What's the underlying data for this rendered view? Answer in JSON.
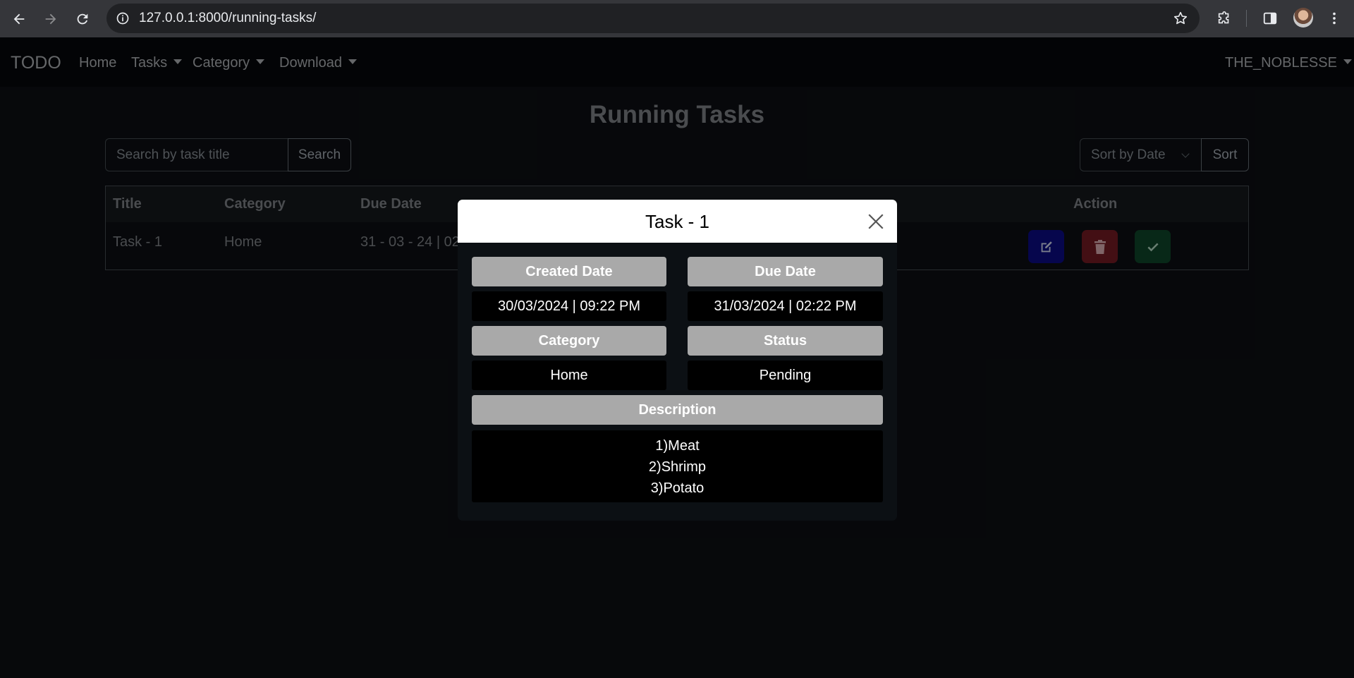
{
  "browser": {
    "url": "127.0.0.1:8000/running-tasks/"
  },
  "navbar": {
    "brand": "TODO",
    "links": [
      "Home",
      "Tasks",
      "Category",
      "Download"
    ],
    "user": "THE_NOBLESSE"
  },
  "page": {
    "title": "Running Tasks",
    "search": {
      "placeholder": "Search by task title",
      "button": "Search"
    },
    "sort": {
      "selected": "Sort by Date",
      "button": "Sort"
    }
  },
  "table": {
    "headers": {
      "title": "Title",
      "category": "Category",
      "due_date": "Due Date",
      "action": "Action"
    },
    "rows": [
      {
        "title": "Task - 1",
        "category": "Home",
        "due_date": "31 - 03 - 24 | 02"
      }
    ]
  },
  "modal": {
    "title": "Task - 1",
    "created_label": "Created Date",
    "created_value": "30/03/2024 | 09:22 PM",
    "due_label": "Due Date",
    "due_value": "31/03/2024 | 02:22 PM",
    "category_label": "Category",
    "category_value": "Home",
    "status_label": "Status",
    "status_value": "Pending",
    "description_label": "Description",
    "description_lines": [
      "1)Meat",
      "2)Shrimp",
      "3)Potato"
    ]
  },
  "colors": {
    "edit_button": "#0b0b8c",
    "delete_button": "#7a1d25",
    "done_button": "#104a2c",
    "modal_label_bg": "#a9a9a9"
  },
  "icons": [
    "back-icon",
    "forward-icon",
    "reload-icon",
    "info-icon",
    "star-icon",
    "extensions-icon",
    "sidepanel-icon",
    "menu-icon",
    "edit-icon",
    "trash-icon",
    "check-icon",
    "close-icon"
  ]
}
